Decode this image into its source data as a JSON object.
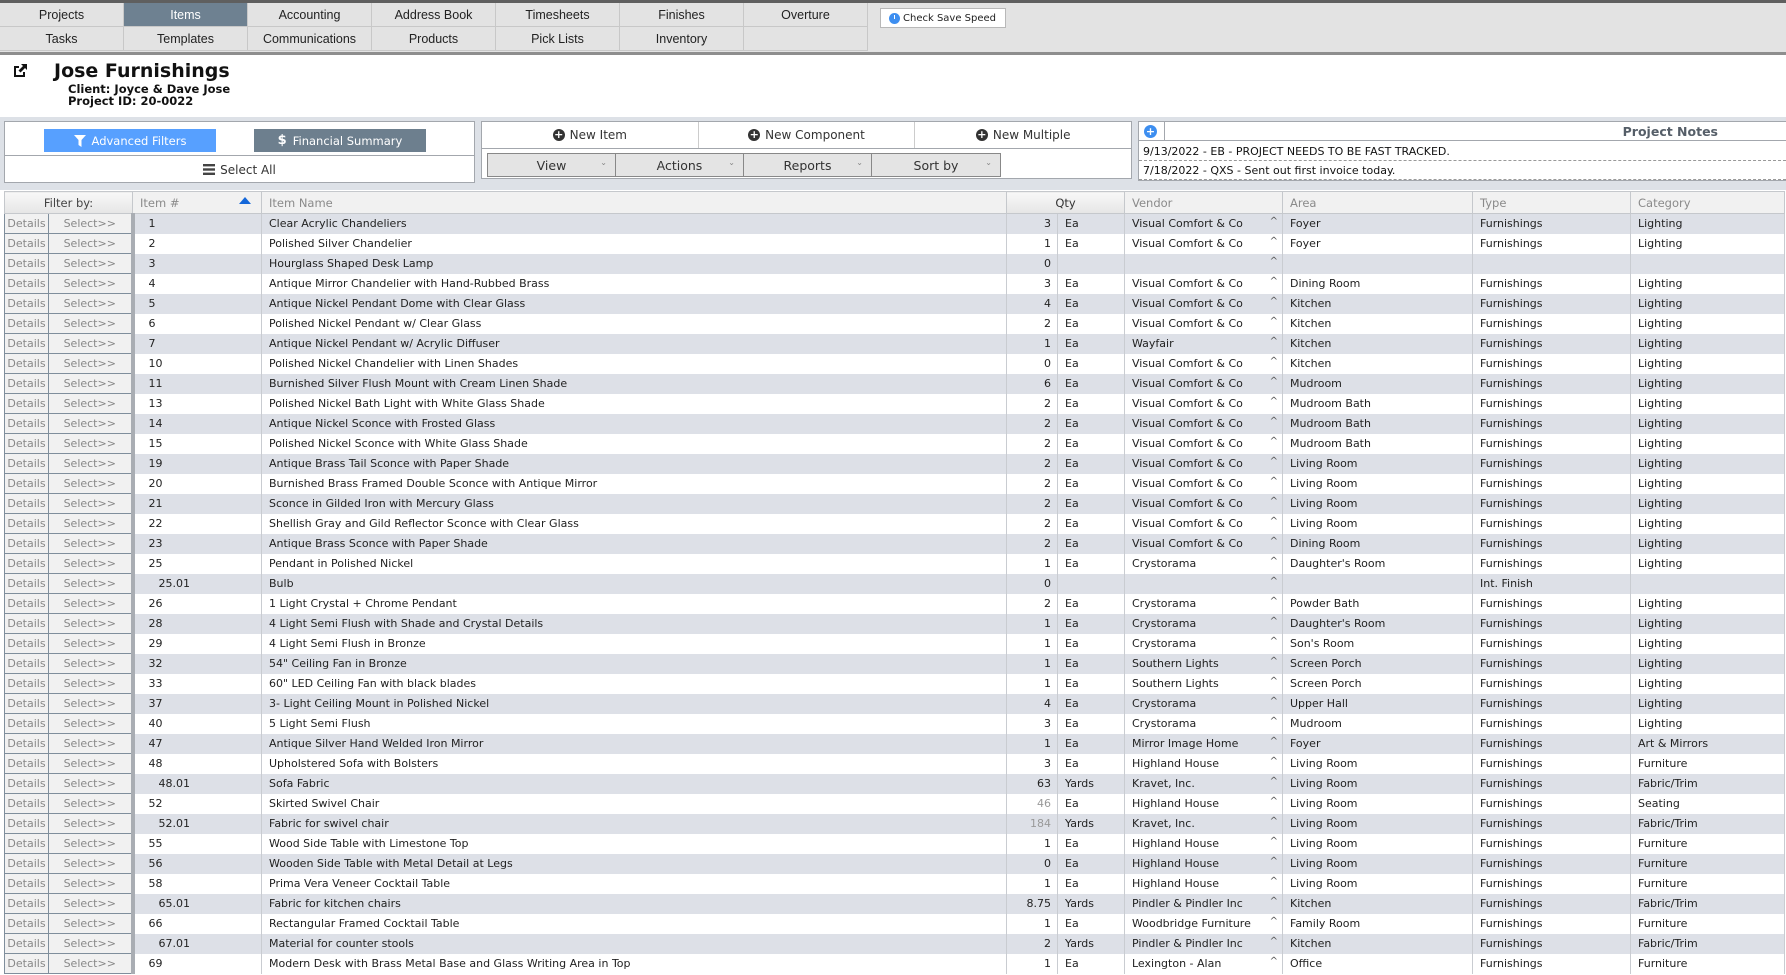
{
  "nav": {
    "row1": [
      {
        "label": "Projects",
        "active": false
      },
      {
        "label": "Items",
        "active": true
      },
      {
        "label": "Accounting",
        "active": false
      },
      {
        "label": "Address Book",
        "active": false
      },
      {
        "label": "Timesheets",
        "active": false
      },
      {
        "label": "Finishes",
        "active": false
      },
      {
        "label": "Overture",
        "active": false
      }
    ],
    "row2": [
      {
        "label": "Tasks"
      },
      {
        "label": "Templates"
      },
      {
        "label": "Communications"
      },
      {
        "label": "Products"
      },
      {
        "label": "Pick Lists"
      },
      {
        "label": "Inventory"
      },
      {
        "label": ""
      }
    ],
    "check_save_speed": "Check Save Speed"
  },
  "project": {
    "title": "Jose Furnishings",
    "client": "Client: Joyce & Dave Jose",
    "project_id": "Project ID: 20-0022"
  },
  "toolbar": {
    "advanced_filters": "Advanced Filters",
    "financial_summary": "Financial Summary",
    "select_all": "Select All",
    "new_item": "New Item",
    "new_component": "New Component",
    "new_multiple": "New Multiple",
    "view": "View",
    "actions": "Actions",
    "reports": "Reports",
    "sort_by": "Sort by"
  },
  "notes": {
    "title": "Project Notes",
    "entries": [
      "9/13/2022 - EB - PROJECT NEEDS TO BE FAST TRACKED.",
      "7/18/2022 - QXS - Sent out first invoice today."
    ]
  },
  "table": {
    "headers": {
      "filter_by": "Filter by:",
      "item_num": "Item #",
      "item_name": "Item Name",
      "qty": "Qty",
      "vendor": "Vendor",
      "area": "Area",
      "type": "Type",
      "category": "Category"
    },
    "details_label": "Details",
    "select_label": "Select>>",
    "sort_column": "Item #",
    "sort_direction": "ascending",
    "rows": [
      {
        "num": "1",
        "name": "Clear Acrylic Chandeliers",
        "qty": "3",
        "unit": "Ea",
        "vendor": "Visual Comfort & Co",
        "area": "Foyer",
        "type": "Furnishings",
        "category": "Lighting"
      },
      {
        "num": "2",
        "name": "Polished Silver Chandelier",
        "qty": "1",
        "unit": "Ea",
        "vendor": "Visual Comfort & Co",
        "area": "Foyer",
        "type": "Furnishings",
        "category": "Lighting"
      },
      {
        "num": "3",
        "name": "Hourglass Shaped Desk Lamp",
        "qty": "0",
        "unit": "",
        "vendor": "",
        "area": "",
        "type": "",
        "category": ""
      },
      {
        "num": "4",
        "name": "Antique Mirror Chandelier with Hand-Rubbed Brass",
        "qty": "3",
        "unit": "Ea",
        "vendor": "Visual Comfort & Co",
        "area": "Dining Room",
        "type": "Furnishings",
        "category": "Lighting"
      },
      {
        "num": "5",
        "name": "Antique Nickel Pendant Dome with Clear Glass",
        "qty": "4",
        "unit": "Ea",
        "vendor": "Visual Comfort & Co",
        "area": "Kitchen",
        "type": "Furnishings",
        "category": "Lighting"
      },
      {
        "num": "6",
        "name": "Polished Nickel Pendant w/ Clear Glass",
        "qty": "2",
        "unit": "Ea",
        "vendor": "Visual Comfort & Co",
        "area": "Kitchen",
        "type": "Furnishings",
        "category": "Lighting"
      },
      {
        "num": "7",
        "name": "Antique Nickel Pendant w/ Acrylic Diffuser",
        "qty": "1",
        "unit": "Ea",
        "vendor": "Wayfair",
        "area": "Kitchen",
        "type": "Furnishings",
        "category": "Lighting"
      },
      {
        "num": "10",
        "name": "Polished Nickel Chandelier with Linen Shades",
        "qty": "0",
        "unit": "Ea",
        "vendor": "Visual Comfort & Co",
        "area": "Kitchen",
        "type": "Furnishings",
        "category": "Lighting"
      },
      {
        "num": "11",
        "name": "Burnished Silver Flush Mount with Cream Linen Shade",
        "qty": "6",
        "unit": "Ea",
        "vendor": "Visual Comfort & Co",
        "area": "Mudroom",
        "type": "Furnishings",
        "category": "Lighting"
      },
      {
        "num": "13",
        "name": "Polished Nickel Bath Light with White Glass Shade",
        "qty": "2",
        "unit": "Ea",
        "vendor": "Visual Comfort & Co",
        "area": "Mudroom Bath",
        "type": "Furnishings",
        "category": "Lighting"
      },
      {
        "num": "14",
        "name": "Antique Nickel Sconce with Frosted Glass",
        "qty": "2",
        "unit": "Ea",
        "vendor": "Visual Comfort & Co",
        "area": "Mudroom Bath",
        "type": "Furnishings",
        "category": "Lighting"
      },
      {
        "num": "15",
        "name": "Polished Nickel Sconce with White Glass Shade",
        "qty": "2",
        "unit": "Ea",
        "vendor": "Visual Comfort & Co",
        "area": "Mudroom Bath",
        "type": "Furnishings",
        "category": "Lighting"
      },
      {
        "num": "19",
        "name": "Antique Brass Tail Sconce with Paper Shade",
        "qty": "2",
        "unit": "Ea",
        "vendor": "Visual Comfort & Co",
        "area": "Living Room",
        "type": "Furnishings",
        "category": "Lighting"
      },
      {
        "num": "20",
        "name": "Burnished Brass Framed Double Sconce with Antique Mirror",
        "qty": "2",
        "unit": "Ea",
        "vendor": "Visual Comfort & Co",
        "area": "Living Room",
        "type": "Furnishings",
        "category": "Lighting"
      },
      {
        "num": "21",
        "name": "Sconce in Gilded Iron with Mercury Glass",
        "qty": "2",
        "unit": "Ea",
        "vendor": "Visual Comfort & Co",
        "area": "Living Room",
        "type": "Furnishings",
        "category": "Lighting"
      },
      {
        "num": "22",
        "name": "Shellish Gray and Gild Reflector Sconce with Clear Glass",
        "qty": "2",
        "unit": "Ea",
        "vendor": "Visual Comfort & Co",
        "area": "Living Room",
        "type": "Furnishings",
        "category": "Lighting"
      },
      {
        "num": "23",
        "name": "Antique Brass Sconce with Paper Shade",
        "qty": "2",
        "unit": "Ea",
        "vendor": "Visual Comfort & Co",
        "area": "Dining Room",
        "type": "Furnishings",
        "category": "Lighting"
      },
      {
        "num": "25",
        "name": "Pendant in Polished Nickel",
        "qty": "1",
        "unit": "Ea",
        "vendor": "Crystorama",
        "area": "Daughter's Room",
        "type": "Furnishings",
        "category": "Lighting"
      },
      {
        "num": "25.01",
        "name": "Bulb",
        "qty": "0",
        "unit": "",
        "vendor": "",
        "area": "",
        "type": "Int. Finish",
        "category": "",
        "sub": true
      },
      {
        "num": "26",
        "name": "1 Light Crystal + Chrome Pendant",
        "qty": "2",
        "unit": "Ea",
        "vendor": "Crystorama",
        "area": "Powder Bath",
        "type": "Furnishings",
        "category": "Lighting"
      },
      {
        "num": "28",
        "name": "4 Light Semi Flush with Shade and Crystal Details",
        "qty": "1",
        "unit": "Ea",
        "vendor": "Crystorama",
        "area": "Daughter's Room",
        "type": "Furnishings",
        "category": "Lighting"
      },
      {
        "num": "29",
        "name": "4 Light Semi Flush in Bronze",
        "qty": "1",
        "unit": "Ea",
        "vendor": "Crystorama",
        "area": "Son's Room",
        "type": "Furnishings",
        "category": "Lighting"
      },
      {
        "num": "32",
        "name": "54\" Ceiling Fan in Bronze",
        "qty": "1",
        "unit": "Ea",
        "vendor": "Southern Lights",
        "area": "Screen Porch",
        "type": "Furnishings",
        "category": "Lighting"
      },
      {
        "num": "33",
        "name": "60\" LED Ceiling Fan with black blades",
        "qty": "1",
        "unit": "Ea",
        "vendor": "Southern Lights",
        "area": "Screen Porch",
        "type": "Furnishings",
        "category": "Lighting"
      },
      {
        "num": "37",
        "name": "3- Light Ceiling Mount in Polished Nickel",
        "qty": "4",
        "unit": "Ea",
        "vendor": "Crystorama",
        "area": "Upper Hall",
        "type": "Furnishings",
        "category": "Lighting"
      },
      {
        "num": "40",
        "name": "5 Light Semi Flush",
        "qty": "3",
        "unit": "Ea",
        "vendor": "Crystorama",
        "area": "Mudroom",
        "type": "Furnishings",
        "category": "Lighting"
      },
      {
        "num": "47",
        "name": "Antique Silver Hand Welded Iron Mirror",
        "qty": "1",
        "unit": "Ea",
        "vendor": "Mirror Image Home",
        "area": "Foyer",
        "type": "Furnishings",
        "category": "Art & Mirrors"
      },
      {
        "num": "48",
        "name": "Upholstered Sofa with Bolsters",
        "qty": "3",
        "unit": "Ea",
        "vendor": "Highland House",
        "area": "Living Room",
        "type": "Furnishings",
        "category": "Furniture"
      },
      {
        "num": "48.01",
        "name": "Sofa Fabric",
        "qty": "63",
        "unit": "Yards",
        "vendor": "Kravet, Inc.",
        "area": "Living Room",
        "type": "Furnishings",
        "category": "Fabric/Trim",
        "sub": true
      },
      {
        "num": "52",
        "name": "Skirted Swivel Chair",
        "qty": "46",
        "unit": "Ea",
        "vendor": "Highland House",
        "area": "Living Room",
        "type": "Furnishings",
        "category": "Seating",
        "dim": true
      },
      {
        "num": "52.01",
        "name": "Fabric for swivel chair",
        "qty": "184",
        "unit": "Yards",
        "vendor": "Kravet, Inc.",
        "area": "Living Room",
        "type": "Furnishings",
        "category": "Fabric/Trim",
        "sub": true,
        "dim": true
      },
      {
        "num": "55",
        "name": "Wood Side Table with Limestone Top",
        "qty": "1",
        "unit": "Ea",
        "vendor": "Highland House",
        "area": "Living Room",
        "type": "Furnishings",
        "category": "Furniture"
      },
      {
        "num": "56",
        "name": "Wooden Side Table with Metal Detail at Legs",
        "qty": "0",
        "unit": "Ea",
        "vendor": "Highland House",
        "area": "Living Room",
        "type": "Furnishings",
        "category": "Furniture"
      },
      {
        "num": "58",
        "name": "Prima Vera Veneer Cocktail Table",
        "qty": "1",
        "unit": "Ea",
        "vendor": "Highland House",
        "area": "Living Room",
        "type": "Furnishings",
        "category": "Furniture"
      },
      {
        "num": "65.01",
        "name": "Fabric for kitchen chairs",
        "qty": "8.75",
        "unit": "Yards",
        "vendor": "Pindler & Pindler Inc",
        "area": "Kitchen",
        "type": "Furnishings",
        "category": "Fabric/Trim",
        "sub": true
      },
      {
        "num": "66",
        "name": "Rectangular Framed Cocktail Table",
        "qty": "1",
        "unit": "Ea",
        "vendor": "Woodbridge Furniture",
        "area": "Family Room",
        "type": "Furnishings",
        "category": "Furniture"
      },
      {
        "num": "67.01",
        "name": "Material for counter stools",
        "qty": "2",
        "unit": "Yards",
        "vendor": "Pindler & Pindler Inc",
        "area": "Kitchen",
        "type": "Furnishings",
        "category": "Fabric/Trim",
        "sub": true
      },
      {
        "num": "69",
        "name": "Modern Desk with Brass Metal Base and Glass Writing Area in Top",
        "qty": "1",
        "unit": "Ea",
        "vendor": "Lexington - Alan",
        "area": "Office",
        "type": "Furnishings",
        "category": "Furniture"
      }
    ]
  },
  "colors": {
    "active_tab": "#6e8191",
    "advanced_filters": "#57a0ff",
    "financial_summary": "#6d7f8e",
    "row_alt": "#dde0e7",
    "sort_arrow": "#1467d9"
  }
}
